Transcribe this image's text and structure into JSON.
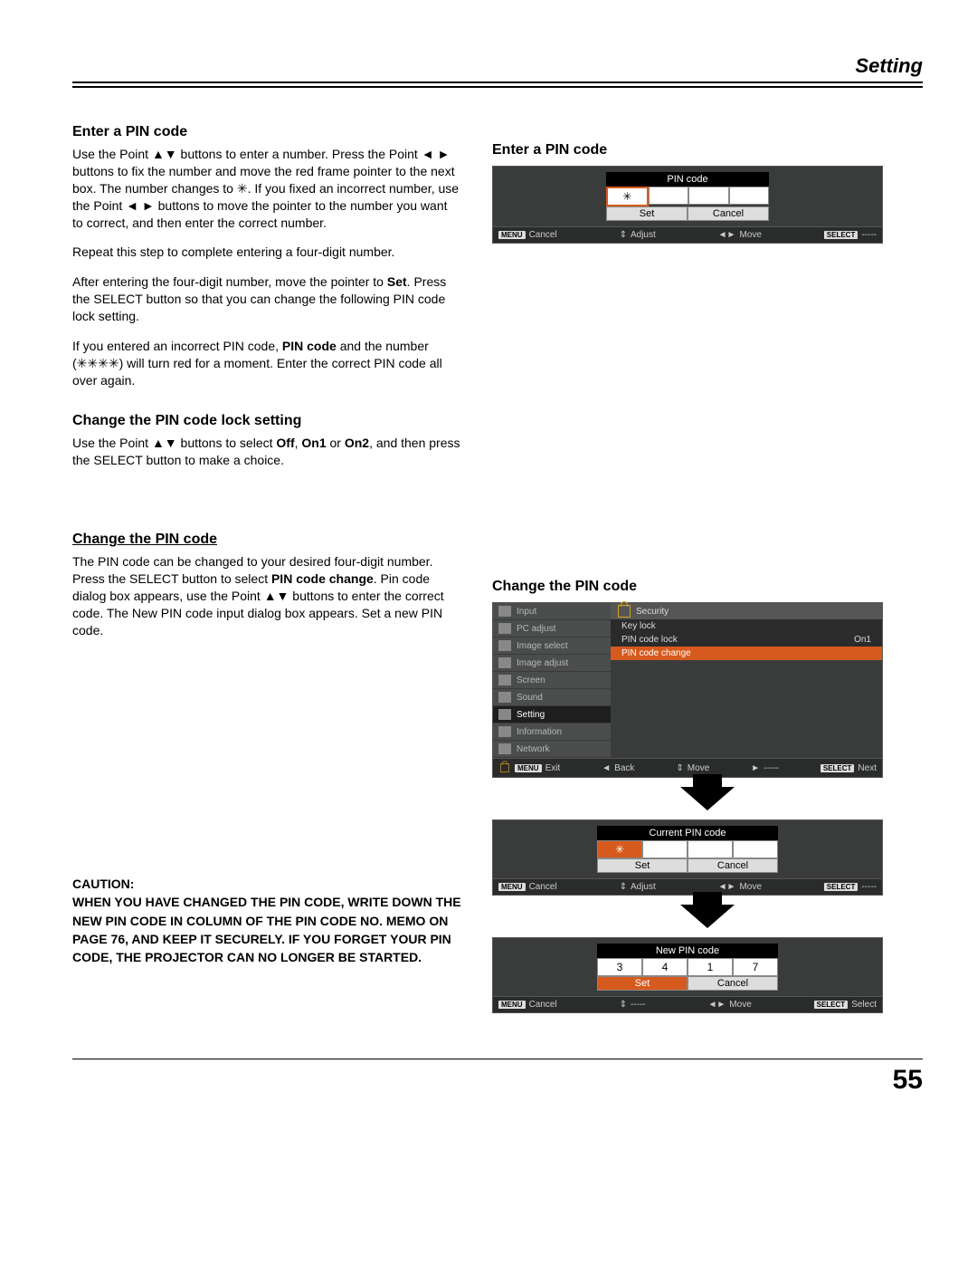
{
  "header": {
    "title": "Setting"
  },
  "left": {
    "h1": "Enter a PIN code",
    "p1a": "Use the Point ▲▼ buttons to enter a number. Press the Point ◄ ► buttons to fix the number and move the red frame pointer to the next box. The number changes to ✳. If you fixed an incorrect number, use the Point ◄ ► buttons to move the pointer to the number you want to correct, and then enter the correct number.",
    "p1b": "Repeat this step to complete entering a four-digit number.",
    "p1c_pre": "After entering the four-digit number, move the pointer to ",
    "p1c_bold": "Set",
    "p1c_post": ". Press the SELECT button so that you can change the following PIN code lock setting.",
    "p1d_pre": "If you entered an incorrect PIN code, ",
    "p1d_b1": "PIN code",
    "p1d_mid": " and the number (✳✳✳✳) will turn red for a moment. Enter the correct PIN code all over again.",
    "h2": "Change the PIN code lock setting",
    "p2_pre": "Use the Point ▲▼ buttons to select ",
    "p2_b1": "Off",
    "p2_c1": ", ",
    "p2_b2": "On1",
    "p2_c2": " or ",
    "p2_b3": "On2",
    "p2_post": ", and then press the SELECT button to make a choice.",
    "h3": "Change the PIN code",
    "p3_pre": "The PIN code can be changed to your desired four-digit number. Press the SELECT button to select ",
    "p3_b1": "PIN code change",
    "p3_post": ". Pin code dialog box appears, use the Point ▲▼ buttons to enter the correct code. The New PIN code input dialog box appears. Set a new PIN code.",
    "caution_label": "CAUTION:",
    "caution_body": "WHEN YOU HAVE CHANGED THE PIN CODE, WRITE DOWN THE NEW PIN CODE IN COLUMN OF THE PIN CODE NO. MEMO ON PAGE 76, AND KEEP IT SECURELY. IF YOU FORGET YOUR PIN CODE, THE PROJECTOR CAN NO LONGER BE STARTED."
  },
  "right": {
    "h1": "Enter a PIN code",
    "pin1": {
      "title": "PIN code",
      "boxes": [
        "✳",
        "",
        "",
        ""
      ],
      "set": "Set",
      "cancel": "Cancel"
    },
    "nav": {
      "menu_tag": "MENU",
      "cancel": "Cancel",
      "adjust": "Adjust",
      "move": "Move",
      "select_tag": "SELECT",
      "dash": "-----",
      "exit": "Exit",
      "back": "Back",
      "next": "Next",
      "select": "Select"
    },
    "h2": "Change the PIN code",
    "menu": {
      "items": [
        "Input",
        "PC adjust",
        "Image select",
        "Image adjust",
        "Screen",
        "Sound",
        "Setting",
        "Information",
        "Network"
      ],
      "selected_index": 6,
      "panel_title": "Security",
      "rows": [
        {
          "label": "Key lock",
          "val": ""
        },
        {
          "label": "PIN code lock",
          "val": "On1"
        },
        {
          "label": "PIN code change",
          "val": ""
        }
      ],
      "hl_index": 2
    },
    "pin_current": {
      "title": "Current PIN code",
      "boxes": [
        "✳",
        "",
        "",
        ""
      ],
      "set": "Set",
      "cancel": "Cancel"
    },
    "pin_new": {
      "title": "New PIN code",
      "boxes": [
        "3",
        "4",
        "1",
        "7"
      ],
      "set": "Set",
      "cancel": "Cancel"
    }
  },
  "page_number": "55"
}
